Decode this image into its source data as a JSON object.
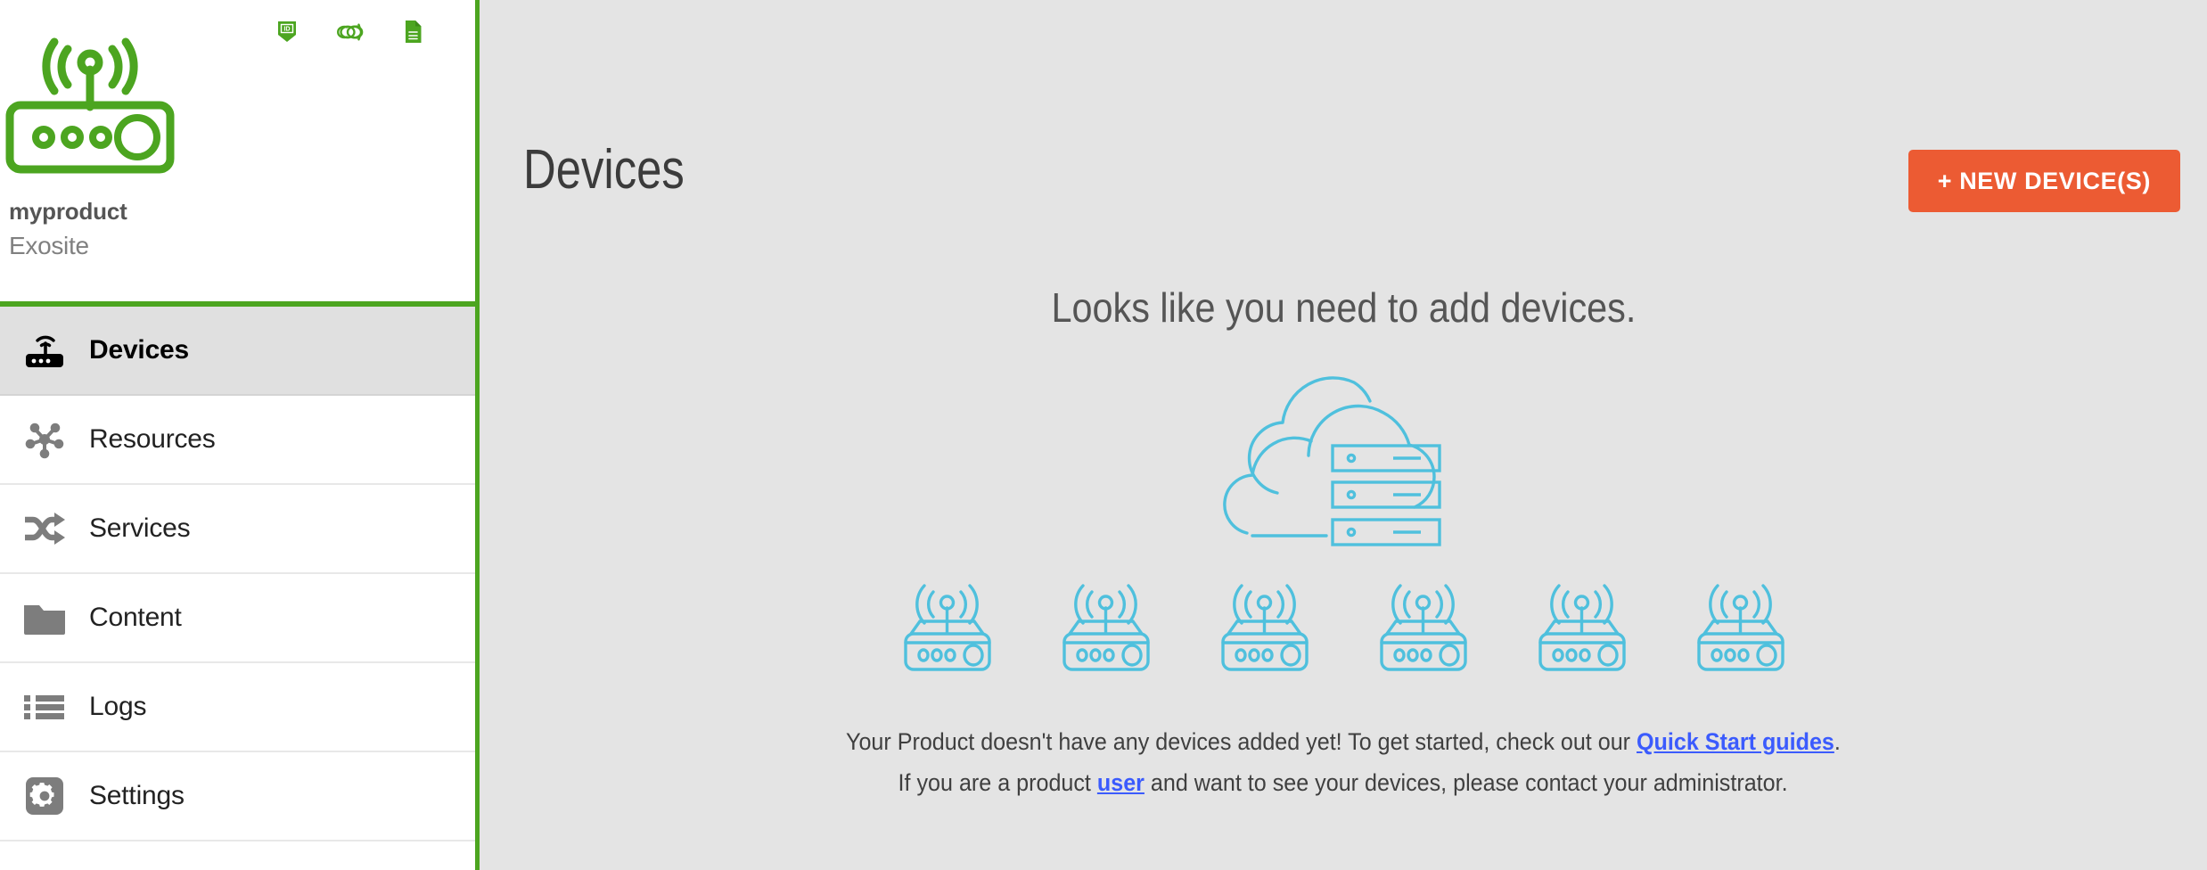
{
  "sidebar": {
    "product_name": "myproduct",
    "organization": "Exosite",
    "logo_icon": "router-signal-icon",
    "header_icons": [
      {
        "name": "id-badge-icon",
        "label": "ID"
      },
      {
        "name": "link-chain-icon",
        "label": ""
      },
      {
        "name": "document-icon",
        "label": ""
      }
    ],
    "nav_items": [
      {
        "label": "Devices",
        "icon": "router-icon",
        "active": true
      },
      {
        "label": "Resources",
        "icon": "hub-nodes-icon",
        "active": false
      },
      {
        "label": "Services",
        "icon": "shuffle-icon",
        "active": false
      },
      {
        "label": "Content",
        "icon": "folder-icon",
        "active": false
      },
      {
        "label": "Logs",
        "icon": "list-icon",
        "active": false
      },
      {
        "label": "Settings",
        "icon": "gear-icon",
        "active": false
      }
    ]
  },
  "main": {
    "page_title": "Devices",
    "new_device_button": "+ NEW DEVICE(S)",
    "empty_heading": "Looks like you need to add devices.",
    "illustration": {
      "cloud_icon": "cloud-server-icon",
      "router_icon": "router-signal-icon",
      "router_count": 6
    },
    "empty_text": {
      "part1": "Your Product doesn't have any devices added yet!  To get started, check out our ",
      "link1": "Quick Start guides",
      "part2": "."
    },
    "empty_text_2": {
      "part1": "If you are a  product ",
      "link1": "user",
      "part2": " and want to see your devices, please contact your administrator."
    }
  },
  "colors": {
    "brand_green": "#4ca520",
    "accent_orange": "#ec5b33",
    "illustration_teal": "#4fc0dd",
    "link_blue": "#3b5bfd",
    "main_bg": "#e4e4e4",
    "sidebar_bg": "#ffffff",
    "active_nav_bg": "#e0e0e0"
  }
}
